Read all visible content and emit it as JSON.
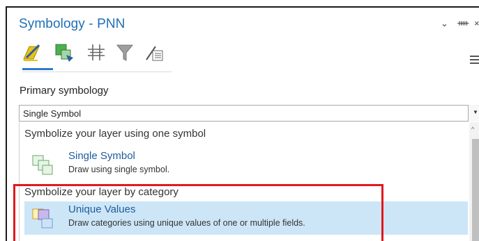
{
  "pane": {
    "title": "Symbology - PNN",
    "controls": {
      "options_icon": "chevron-down-icon",
      "pin_icon": "pin-icon",
      "close_icon": "close-icon"
    }
  },
  "tabs": [
    {
      "icon": "primary-symbology-icon",
      "active": true
    },
    {
      "icon": "vary-symbology-icon",
      "active": false
    },
    {
      "icon": "symbol-layer-drawing-icon",
      "active": false
    },
    {
      "icon": "filter-icon",
      "active": false
    },
    {
      "icon": "label-properties-icon",
      "active": false
    }
  ],
  "section": {
    "label": "Primary symbology"
  },
  "primary_select": {
    "value": "Single Symbol"
  },
  "list": {
    "groups": [
      {
        "header": "Symbolize your layer using one symbol",
        "items": [
          {
            "title": "Single Symbol",
            "description": "Draw using single symbol.",
            "icon": "single-symbol-icon",
            "selected": false
          }
        ]
      },
      {
        "header": "Symbolize your layer by category",
        "items": [
          {
            "title": "Unique Values",
            "description": "Draw categories using unique values of one or multiple fields.",
            "icon": "unique-values-icon",
            "selected": true
          }
        ]
      }
    ]
  },
  "colors": {
    "title_blue": "#1f6fb5",
    "selection_bg": "#cde6f7",
    "highlight_red": "#e0191e",
    "tab_underline": "#2b7bd0"
  }
}
